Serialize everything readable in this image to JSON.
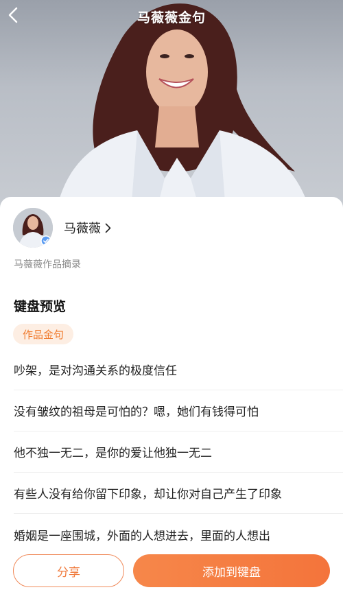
{
  "header": {
    "title": "马薇薇金句",
    "back_icon": "chevron-left-icon"
  },
  "author": {
    "name": "马薇薇",
    "subtitle": "马薇薇作品摘录",
    "verified_icon": "verified-badge-icon"
  },
  "section": {
    "title": "键盘预览",
    "tag": "作品金句"
  },
  "quotes": [
    "吵架，是对沟通关系的极度信任",
    "没有皱纹的祖母是可怕的？嗯，她们有钱得可怕",
    "他不独一无二，是你的爱让他独一无二",
    "有些人没有给你留下印象，却让你对自己产生了印象",
    "婚姻是一座围城，外面的人想进去，里面的人想出"
  ],
  "actions": {
    "share_label": "分享",
    "add_label": "添加到键盘"
  },
  "colors": {
    "accent": "#f4763c",
    "tag_bg": "#fdeee3"
  }
}
